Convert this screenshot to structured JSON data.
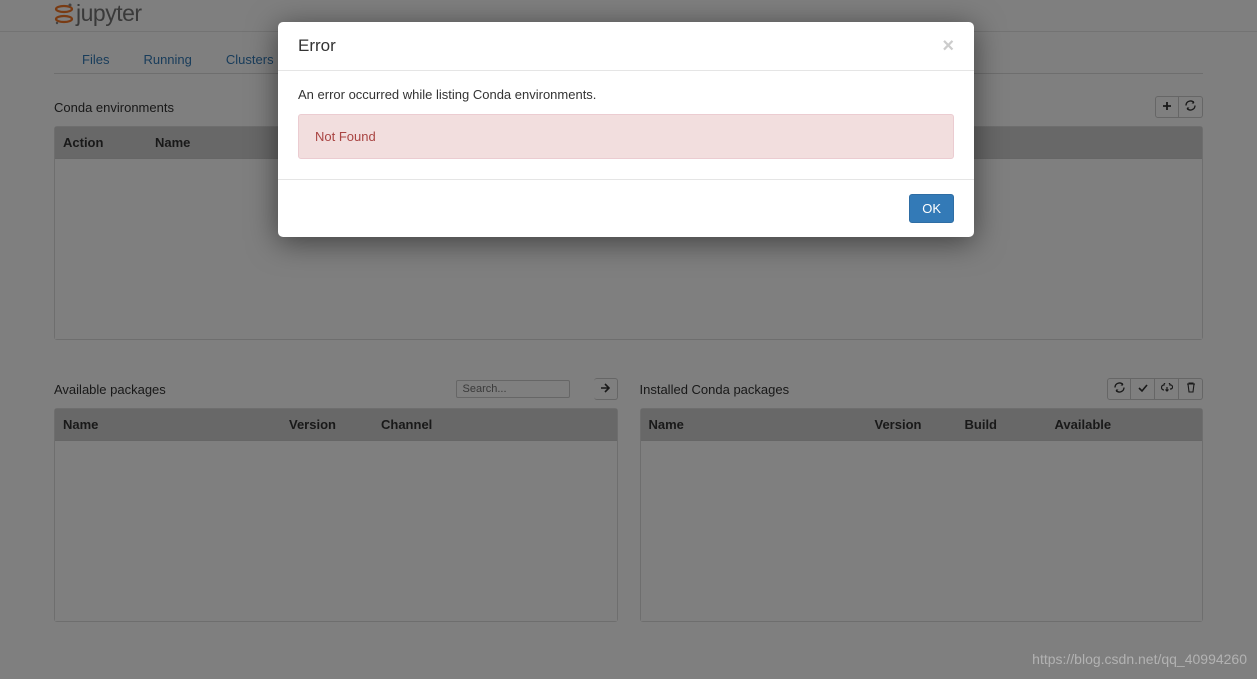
{
  "header": {
    "logo_text": "jupyter"
  },
  "tabs": {
    "files": "Files",
    "running": "Running",
    "clusters": "Clusters"
  },
  "environments": {
    "title": "Conda environments",
    "columns": {
      "action": "Action",
      "name": "Name"
    }
  },
  "available_packages": {
    "title": "Available packages",
    "search_placeholder": "Search...",
    "columns": {
      "name": "Name",
      "version": "Version",
      "channel": "Channel"
    }
  },
  "installed_packages": {
    "title": "Installed Conda packages",
    "columns": {
      "name": "Name",
      "version": "Version",
      "build": "Build",
      "available": "Available"
    }
  },
  "modal": {
    "title": "Error",
    "message": "An error occurred while listing Conda environments.",
    "error_text": "Not Found",
    "ok_label": "OK"
  },
  "watermark": "https://blog.csdn.net/qq_40994260"
}
